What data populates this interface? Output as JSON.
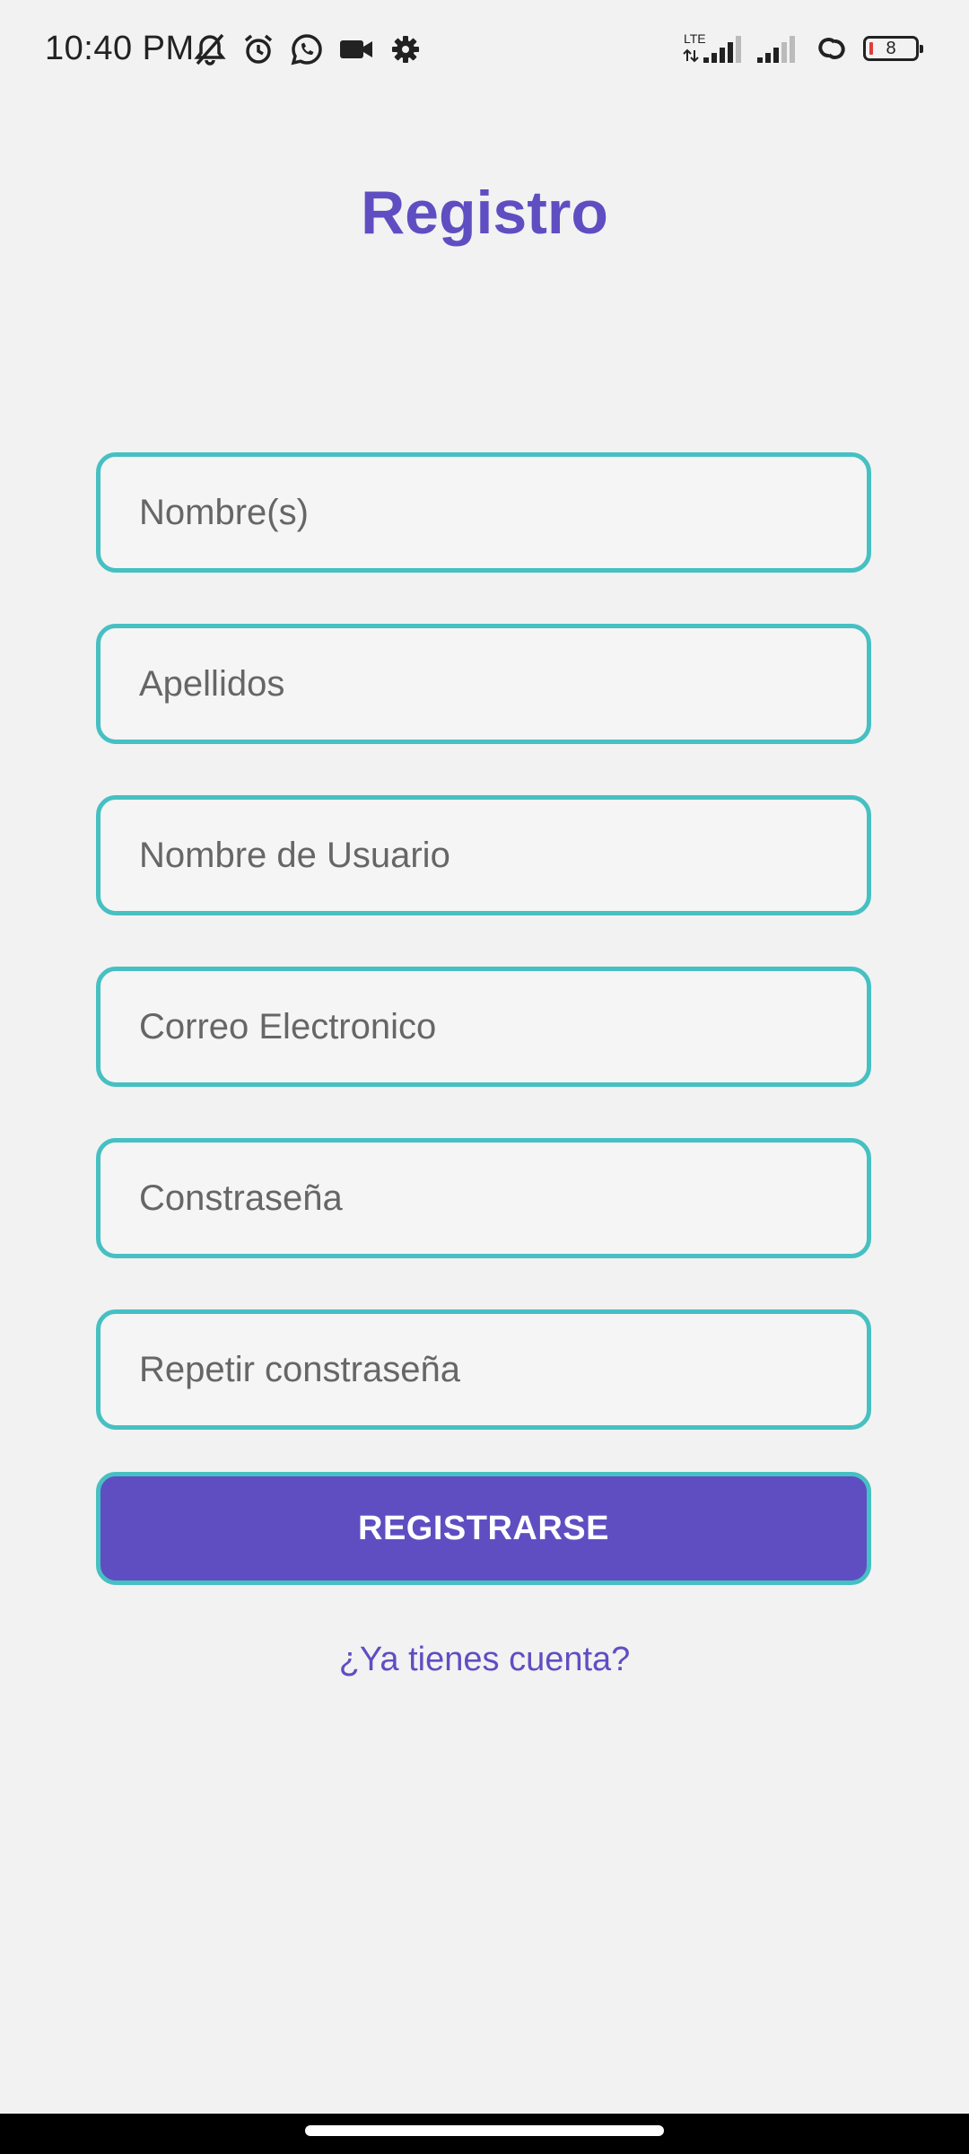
{
  "status_bar": {
    "time": "10:40 PM",
    "network_label": "LTE",
    "battery_level": "8",
    "left_icons": [
      "mute-icon",
      "alarm-icon",
      "whatsapp-icon",
      "video-camera-icon",
      "gear-icon"
    ],
    "right_icons": [
      "lte-signal-icon",
      "signal-icon",
      "link-icon",
      "battery-icon"
    ]
  },
  "header": {
    "title": "Registro"
  },
  "form": {
    "fields": [
      {
        "placeholder": "Nombre(s)",
        "value": ""
      },
      {
        "placeholder": "Apellidos",
        "value": ""
      },
      {
        "placeholder": "Nombre de Usuario",
        "value": ""
      },
      {
        "placeholder": "Correo Electronico",
        "value": ""
      },
      {
        "placeholder": "Constraseña",
        "value": ""
      },
      {
        "placeholder": "Repetir constraseña",
        "value": ""
      }
    ],
    "submit_label": "REGISTRARSE",
    "login_link": "¿Ya tienes cuenta?"
  },
  "colors": {
    "accent": "#5f4ec2",
    "field_border": "#46c0c2",
    "background": "#f2f2f2"
  }
}
